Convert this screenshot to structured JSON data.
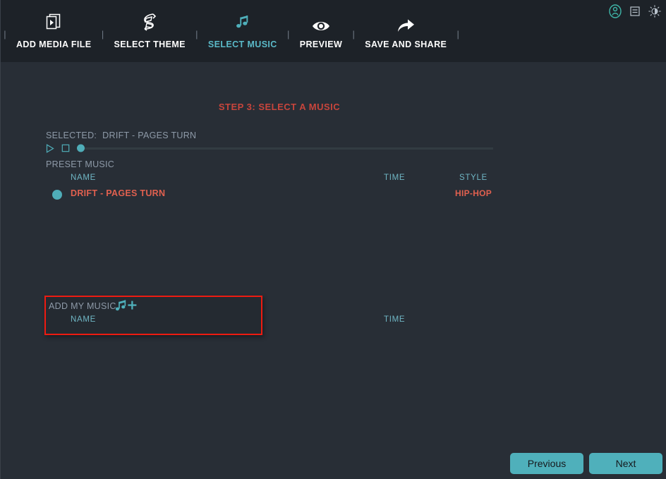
{
  "window": {
    "titlebar_icons": [
      {
        "name": "account-icon",
        "glyph": "user-circle"
      },
      {
        "name": "menu-icon",
        "glyph": "list-box"
      },
      {
        "name": "brightness-icon",
        "glyph": "sun-half"
      }
    ]
  },
  "nav": {
    "separator": "|",
    "steps": [
      {
        "label": "ADD MEDIA FILE",
        "icon": "media-file-icon",
        "active": false
      },
      {
        "label": "SELECT THEME",
        "icon": "theme-ribbon-icon",
        "active": false
      },
      {
        "label": "SELECT MUSIC",
        "icon": "music-note-icon",
        "active": true
      },
      {
        "label": "PREVIEW",
        "icon": "eye-icon",
        "active": false
      },
      {
        "label": "SAVE AND SHARE",
        "icon": "share-arrow-icon",
        "active": false
      }
    ]
  },
  "main": {
    "step_title": "STEP 3: SELECT A MUSIC",
    "selected": {
      "label": "SELECTED:",
      "value": "DRIFT - PAGES TURN"
    },
    "player": {
      "play_label": "play-button",
      "stop_label": "stop-button",
      "progress_percent": 0
    },
    "preset_music": {
      "section_label": "PRESET MUSIC",
      "columns": {
        "name": "NAME",
        "time": "TIME",
        "style": "STYLE"
      },
      "rows": [
        {
          "name": "DRIFT - PAGES TURN",
          "time": "",
          "style": "HIP-HOP",
          "selected": true
        }
      ]
    },
    "add_my_music": {
      "label": "ADD MY MUSIC",
      "add_icon": "add-music-note-icon",
      "columns": {
        "name": "NAME",
        "time": "TIME"
      },
      "rows": []
    }
  },
  "footer": {
    "previous_label": "Previous",
    "next_label": "Next"
  },
  "colors": {
    "accent_teal": "#4fb0bb",
    "accent_red": "#e0604f",
    "title_red": "#c8453c",
    "highlight_border": "#ee1b11",
    "header_bg": "#1d2228",
    "body_bg": "#282e36",
    "muted_text": "#8e9aa8"
  }
}
